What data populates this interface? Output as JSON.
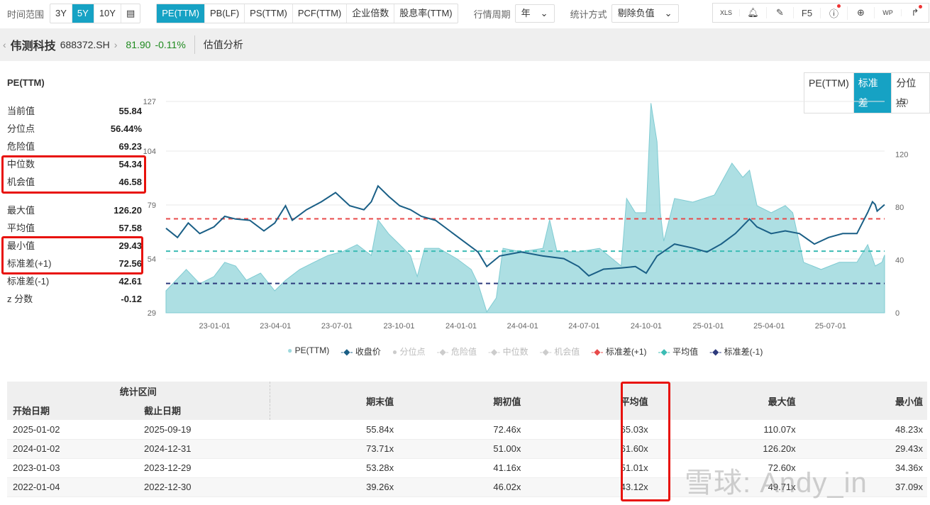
{
  "topbar": {
    "range_label": "时间范围",
    "ranges": [
      "3Y",
      "5Y",
      "10Y"
    ],
    "active_range": "5Y",
    "metrics": [
      "PE(TTM)",
      "PB(LF)",
      "PS(TTM)",
      "PCF(TTM)",
      "企业倍数",
      "股息率(TTM)"
    ],
    "active_metric": "PE(TTM)",
    "period_label": "行情周期",
    "period_value": "年",
    "stat_label": "统计方式",
    "stat_value": "剔除负值",
    "tools": [
      "XLS",
      "bell",
      "edit",
      "F5",
      "help",
      "add",
      "WP",
      "share"
    ]
  },
  "stock": {
    "name": "伟测科技",
    "code": "688372.SH",
    "price": "81.90",
    "change": "-0.11%",
    "section": "估值分析"
  },
  "left": {
    "title": "PE(TTM)",
    "stats1": [
      {
        "k": "当前值",
        "v": "55.84"
      },
      {
        "k": "分位点",
        "v": "56.44%"
      },
      {
        "k": "危险值",
        "v": "69.23"
      },
      {
        "k": "中位数",
        "v": "54.34"
      },
      {
        "k": "机会值",
        "v": "46.58"
      }
    ],
    "stats2": [
      {
        "k": "最大值",
        "v": "126.20"
      },
      {
        "k": "平均值",
        "v": "57.58"
      },
      {
        "k": "最小值",
        "v": "29.43"
      },
      {
        "k": "标准差(+1)",
        "v": "72.56"
      },
      {
        "k": "标准差(-1)",
        "v": "42.61"
      },
      {
        "k": "z 分数",
        "v": "-0.12"
      }
    ]
  },
  "view_tabs": [
    "PE(TTM)",
    "标准差",
    "分位点"
  ],
  "active_view": "标准差",
  "colors": {
    "accent": "#16a2c4",
    "area": "#9fd9de",
    "price": "#1a5f86",
    "plus1": "#e84a4a",
    "mean": "#3cbcb4",
    "minus1": "#2d3a7c"
  },
  "chart_data": {
    "type": "line",
    "left_axis": {
      "range": [
        29,
        127
      ],
      "ticks": [
        29,
        54,
        79,
        104,
        127
      ]
    },
    "right_axis": {
      "range": [
        0,
        160
      ],
      "ticks": [
        0,
        40,
        80,
        120,
        160
      ]
    },
    "x_ticks": [
      "23-01-01",
      "23-04-01",
      "23-07-01",
      "23-10-01",
      "24-01-01",
      "24-04-01",
      "24-07-01",
      "24-10-01",
      "25-01-01",
      "25-04-01",
      "25-07-01"
    ],
    "x_tick_dates": [
      "2023-01-01",
      "2023-04-01",
      "2023-07-01",
      "2023-10-01",
      "2024-01-01",
      "2024-04-01",
      "2024-07-01",
      "2024-10-01",
      "2025-01-01",
      "2025-04-01",
      "2025-07-01"
    ],
    "hlines": {
      "plus1": 72.56,
      "mean": 57.58,
      "minus1": 42.61
    },
    "legend": [
      {
        "name": "PE(TTM)",
        "on": true
      },
      {
        "name": "收盘价",
        "on": true
      },
      {
        "name": "分位点",
        "on": false
      },
      {
        "name": "危险值",
        "on": false
      },
      {
        "name": "中位数",
        "on": false
      },
      {
        "name": "机会值",
        "on": false
      },
      {
        "name": "标准差(+1)",
        "on": true
      },
      {
        "name": "平均值",
        "on": true
      },
      {
        "name": "标准差(-1)",
        "on": true
      }
    ],
    "pe": [
      [
        "2022-10-21",
        39.2
      ],
      [
        "2022-11-20",
        49.1
      ],
      [
        "2022-12-10",
        42.5
      ],
      [
        "2022-12-31",
        45.8
      ],
      [
        "2023-01-16",
        52.4
      ],
      [
        "2023-02-01",
        50.7
      ],
      [
        "2023-02-17",
        44.1
      ],
      [
        "2023-03-10",
        47.4
      ],
      [
        "2023-03-31",
        39.2
      ],
      [
        "2023-04-16",
        44.1
      ],
      [
        "2023-05-07",
        49.1
      ],
      [
        "2023-05-28",
        52.4
      ],
      [
        "2023-06-18",
        55.6
      ],
      [
        "2023-07-09",
        57.3
      ],
      [
        "2023-07-31",
        60.6
      ],
      [
        "2023-08-21",
        55.6
      ],
      [
        "2023-08-31",
        72.1
      ],
      [
        "2023-09-16",
        65.5
      ],
      [
        "2023-10-02",
        60.6
      ],
      [
        "2023-10-18",
        55.6
      ],
      [
        "2023-10-28",
        45.8
      ],
      [
        "2023-11-08",
        58.9
      ],
      [
        "2023-11-29",
        58.9
      ],
      [
        "2023-12-26",
        54.0
      ],
      [
        "2024-01-16",
        49.1
      ],
      [
        "2024-01-26",
        42.5
      ],
      [
        "2024-02-08",
        29.4
      ],
      [
        "2024-02-22",
        35.9
      ],
      [
        "2024-03-03",
        58.9
      ],
      [
        "2024-03-30",
        57.3
      ],
      [
        "2024-05-01",
        58.9
      ],
      [
        "2024-05-11",
        72.1
      ],
      [
        "2024-05-22",
        57.3
      ],
      [
        "2024-06-23",
        57.3
      ],
      [
        "2024-07-24",
        58.9
      ],
      [
        "2024-08-25",
        50.7
      ],
      [
        "2024-09-02",
        82.0
      ],
      [
        "2024-09-15",
        75.4
      ],
      [
        "2024-10-01",
        75.4
      ],
      [
        "2024-10-08",
        126.2
      ],
      [
        "2024-10-17",
        108.3
      ],
      [
        "2024-10-22",
        75.4
      ],
      [
        "2024-10-27",
        62.2
      ],
      [
        "2024-11-12",
        82.0
      ],
      [
        "2024-12-09",
        80.3
      ],
      [
        "2025-01-10",
        83.6
      ],
      [
        "2025-02-05",
        98.4
      ],
      [
        "2025-02-21",
        91.8
      ],
      [
        "2025-03-03",
        95.1
      ],
      [
        "2025-03-14",
        78.7
      ],
      [
        "2025-04-04",
        75.4
      ],
      [
        "2025-04-25",
        78.7
      ],
      [
        "2025-05-06",
        75.4
      ],
      [
        "2025-05-22",
        52.4
      ],
      [
        "2025-06-17",
        49.1
      ],
      [
        "2025-07-14",
        52.4
      ],
      [
        "2025-08-09",
        52.4
      ],
      [
        "2025-08-25",
        60.6
      ],
      [
        "2025-09-05",
        50.7
      ],
      [
        "2025-09-15",
        52.4
      ],
      [
        "2025-09-19",
        55.84
      ]
    ],
    "price": [
      [
        "2022-10-21",
        64
      ],
      [
        "2022-11-07",
        57
      ],
      [
        "2022-11-23",
        68
      ],
      [
        "2022-12-10",
        60
      ],
      [
        "2022-12-31",
        65
      ],
      [
        "2023-01-16",
        73
      ],
      [
        "2023-02-01",
        71
      ],
      [
        "2023-02-22",
        70
      ],
      [
        "2023-03-15",
        62
      ],
      [
        "2023-03-31",
        68
      ],
      [
        "2023-04-16",
        81
      ],
      [
        "2023-04-26",
        70
      ],
      [
        "2023-05-17",
        78
      ],
      [
        "2023-06-08",
        84
      ],
      [
        "2023-06-29",
        91
      ],
      [
        "2023-07-20",
        81
      ],
      [
        "2023-08-10",
        78
      ],
      [
        "2023-08-21",
        84
      ],
      [
        "2023-08-31",
        96
      ],
      [
        "2023-09-16",
        88
      ],
      [
        "2023-10-02",
        81
      ],
      [
        "2023-10-18",
        78
      ],
      [
        "2023-11-03",
        73
      ],
      [
        "2023-11-24",
        70
      ],
      [
        "2023-12-15",
        62
      ],
      [
        "2024-01-05",
        54
      ],
      [
        "2024-01-26",
        46
      ],
      [
        "2024-02-08",
        35
      ],
      [
        "2024-02-27",
        43
      ],
      [
        "2024-03-30",
        46
      ],
      [
        "2024-05-01",
        43
      ],
      [
        "2024-06-01",
        41
      ],
      [
        "2024-06-23",
        35
      ],
      [
        "2024-07-08",
        28
      ],
      [
        "2024-07-30",
        33
      ],
      [
        "2024-08-25",
        34
      ],
      [
        "2024-09-15",
        35
      ],
      [
        "2024-10-01",
        30
      ],
      [
        "2024-10-17",
        43
      ],
      [
        "2024-11-12",
        52
      ],
      [
        "2024-12-09",
        49
      ],
      [
        "2024-12-30",
        46
      ],
      [
        "2025-01-20",
        52
      ],
      [
        "2025-02-10",
        60
      ],
      [
        "2025-03-03",
        71
      ],
      [
        "2025-03-14",
        65
      ],
      [
        "2025-04-04",
        60
      ],
      [
        "2025-04-25",
        62
      ],
      [
        "2025-05-16",
        60
      ],
      [
        "2025-06-07",
        52
      ],
      [
        "2025-06-28",
        57
      ],
      [
        "2025-07-19",
        60
      ],
      [
        "2025-08-09",
        60
      ],
      [
        "2025-08-25",
        76
      ],
      [
        "2025-09-05",
        82
      ],
      [
        "2025-09-01",
        84
      ],
      [
        "2025-09-08",
        77
      ],
      [
        "2025-09-19",
        81.9
      ]
    ]
  },
  "table": {
    "group_header": "统计区间",
    "headers": [
      "开始日期",
      "截止日期",
      "期末值",
      "期初值",
      "平均值",
      "最大值",
      "最小值"
    ],
    "rows": [
      [
        "2025-01-02",
        "2025-09-19",
        "55.84x",
        "72.46x",
        "65.03x",
        "110.07x",
        "48.23x"
      ],
      [
        "2024-01-02",
        "2024-12-31",
        "73.71x",
        "51.00x",
        "61.60x",
        "126.20x",
        "29.43x"
      ],
      [
        "2023-01-03",
        "2023-12-29",
        "53.28x",
        "41.16x",
        "51.01x",
        "72.60x",
        "34.36x"
      ],
      [
        "2022-01-04",
        "2022-12-30",
        "39.26x",
        "46.02x",
        "43.12x",
        "49.71x",
        "37.09x"
      ]
    ]
  },
  "watermark": "雪球: Andy_in"
}
